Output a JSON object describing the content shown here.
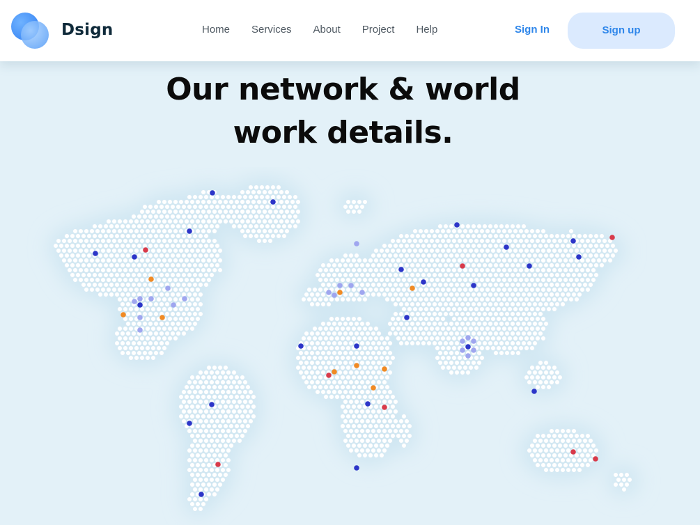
{
  "brand": {
    "name": "Dsign",
    "logo_icon": "overlapping-circles-logo"
  },
  "nav": {
    "links": [
      "Home",
      "Services",
      "About",
      "Project",
      "Help"
    ],
    "signin": "Sign In",
    "signup": "Sign up"
  },
  "hero": {
    "line1": "Our network & world",
    "line2": "work details."
  },
  "colors": {
    "accent": "#2e86ea",
    "marker_blue": "#2c35c8",
    "marker_red": "#d83a4a",
    "marker_orange": "#f08a24",
    "marker_lavender": "#9fa6ef"
  }
}
